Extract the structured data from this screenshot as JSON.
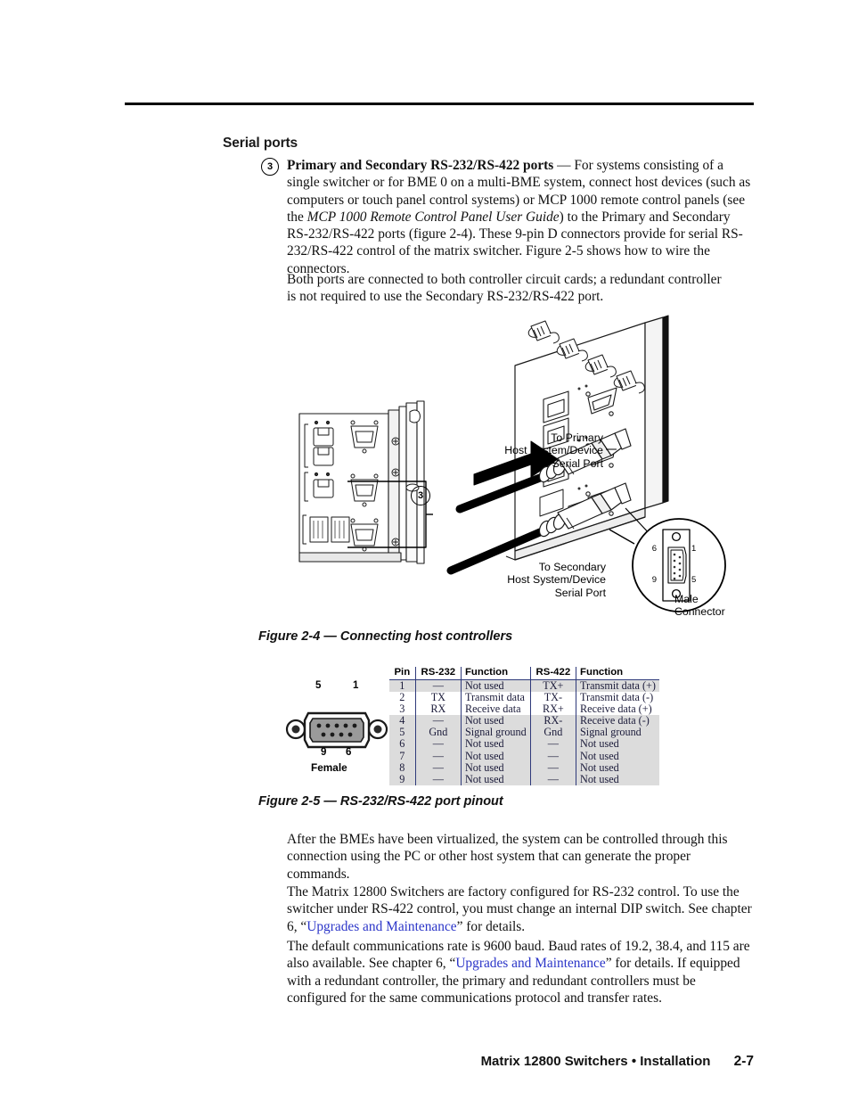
{
  "page": {
    "section_heading": "Serial ports",
    "callout_number": "3",
    "footer_title": "Matrix 12800 Switchers • Installation",
    "footer_page": "2-7"
  },
  "body": {
    "callout_paragraph_bold": "Primary and Secondary RS-232/RS-422 ports",
    "callout_paragraph_dash": " — ",
    "callout_paragraph_part1": "For systems consisting of a single switcher or for BME 0 on a multi-BME system, connect host devices (such as computers or touch panel control systems) or MCP 1000 remote control panels (see the ",
    "callout_paragraph_italic": "MCP 1000 Remote Control Panel User Guide",
    "callout_paragraph_part2": ") to the Primary and Secondary RS-232/RS-422 ports (figure 2-4).  These 9-pin D connectors provide for serial RS-232/RS-422 control of the matrix switcher.  Figure 2-5 shows how to wire the connectors.",
    "both_ports_paragraph": "Both ports are connected to both controller circuit cards; a redundant controller is not required to use the Secondary RS-232/RS-422 port.",
    "after_bmes_paragraph": "After the BMEs have been virtualized, the system can be controlled through this connection using the PC or other host system that can generate the proper commands.",
    "matrix_paragraph_part1": "The Matrix 12800 Switchers are factory configured for RS-232 control.  To use the switcher under RS-422 control, you must change an internal DIP switch.  See chapter 6, “",
    "matrix_paragraph_link": "Upgrades and Maintenance",
    "matrix_paragraph_part2": "” for details.",
    "baud_paragraph_part1": "The default communications rate is 9600 baud.  Baud rates of 19.2, 38.4, and 115 are also available.  See chapter 6, “",
    "baud_paragraph_link": "Upgrades and Maintenance",
    "baud_paragraph_part2": "” for details. If equipped with a redundant controller, the primary and redundant controllers must be configured for the same communications protocol and transfer rates."
  },
  "figure24": {
    "caption": "Figure 2-4 — Connecting host controllers",
    "label_primary": "To Primary\nHost System/Device\nSerial Port",
    "label_secondary": "To Secondary\nHost System/Device\nSerial Port",
    "label_male": "Male\nConnector",
    "callout_number": "3",
    "male_pins": {
      "top_left": "6",
      "top_right": "1",
      "bottom_left": "9",
      "bottom_right": "5"
    }
  },
  "figure25": {
    "caption": "Figure 2-5 — RS-232/RS-422 port pinout",
    "connector_label": "Female",
    "connector_pins": {
      "top_left": "5",
      "top_right": "1",
      "bottom_left": "9",
      "bottom_right": "6"
    },
    "table": {
      "headers": [
        "Pin",
        "RS-232",
        "Function",
        "RS-422",
        "Function"
      ],
      "rows": [
        {
          "pin": "1",
          "rs232": "—",
          "fn232": "Not used",
          "rs422": "TX+",
          "fn422": "Transmit data (+)",
          "shaded": true
        },
        {
          "pin": "2",
          "rs232": "TX",
          "fn232": "Transmit data",
          "rs422": "TX-",
          "fn422": "Transmit data (-)",
          "shaded": false
        },
        {
          "pin": "3",
          "rs232": "RX",
          "fn232": "Receive data",
          "rs422": "RX+",
          "fn422": "Receive data (+)",
          "shaded": false
        },
        {
          "pin": "4",
          "rs232": "—",
          "fn232": "Not used",
          "rs422": "RX-",
          "fn422": "Receive data (-)",
          "shaded": true
        },
        {
          "pin": "5",
          "rs232": "Gnd",
          "fn232": "Signal ground",
          "rs422": "Gnd",
          "fn422": "Signal ground",
          "shaded": true
        },
        {
          "pin": "6",
          "rs232": "—",
          "fn232": "Not used",
          "rs422": "—",
          "fn422": "Not used",
          "shaded": true
        },
        {
          "pin": "7",
          "rs232": "—",
          "fn232": "Not used",
          "rs422": "—",
          "fn422": "Not used",
          "shaded": true
        },
        {
          "pin": "8",
          "rs232": "—",
          "fn232": "Not used",
          "rs422": "—",
          "fn422": "Not used",
          "shaded": true
        },
        {
          "pin": "9",
          "rs232": "—",
          "fn232": "Not used",
          "rs422": "—",
          "fn422": "Not used",
          "shaded": true
        }
      ]
    }
  },
  "colors": {
    "link": "#2b35c8",
    "table_rule": "#2f3a7a",
    "table_shade": "#dcdcdc",
    "text": "#111111"
  }
}
